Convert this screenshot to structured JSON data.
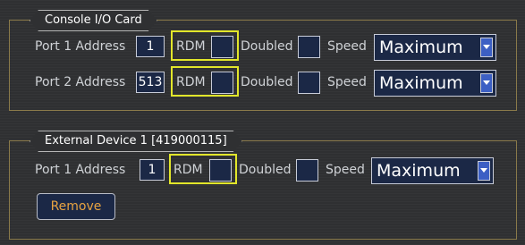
{
  "console_card": {
    "title": "Console I/O Card",
    "rows": [
      {
        "port_label": "Port 1 Address",
        "address": "1",
        "rdm_label": "RDM",
        "doubled_label": "Doubled",
        "speed_label": "Speed",
        "speed_value": "Maximum"
      },
      {
        "port_label": "Port 2 Address",
        "address": "513",
        "rdm_label": "RDM",
        "doubled_label": "Doubled",
        "speed_label": "Speed",
        "speed_value": "Maximum"
      }
    ]
  },
  "external_device": {
    "title": "External Device 1  [419000115]",
    "rows": [
      {
        "port_label": "Port 1 Address",
        "address": "1",
        "rdm_label": "RDM",
        "doubled_label": "Doubled",
        "speed_label": "Speed",
        "speed_value": "Maximum"
      }
    ],
    "remove_label": "Remove"
  },
  "colors": {
    "highlight": "#e2e62a",
    "field_bg": "#1b2846",
    "remove_text": "#e8a341"
  },
  "icons": {
    "dropdown": "chevron-down-icon"
  }
}
